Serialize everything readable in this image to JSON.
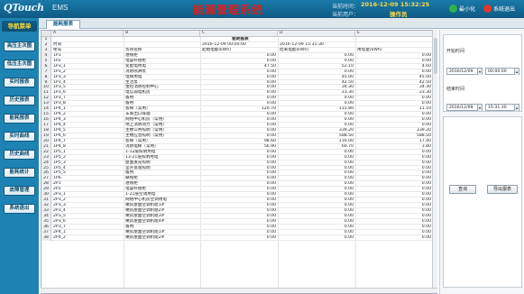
{
  "header": {
    "logo": "QTouch",
    "logo_sub": "EMS",
    "title": "能源管理系统",
    "time_label": "当前时间：",
    "time_value": "2016-12-09 15:32:25",
    "user_label": "当前用户：",
    "user_value": "操作员",
    "minimize_label": "最小化",
    "exit_label": "系统退出"
  },
  "sidebar": {
    "title": "导航菜单",
    "items": [
      "高压主次图",
      "低压主次图",
      "实时报表",
      "历史报表",
      "能耗报表",
      "实时曲线",
      "历史曲线",
      "能耗统计",
      "故障管理",
      "系统退出"
    ]
  },
  "tab": {
    "label": "能耗报表"
  },
  "sheet": {
    "columns": [
      "A",
      "B",
      "C",
      "D",
      "E"
    ],
    "title": "能耗报表",
    "time_label": "时间",
    "start_time": "2016-12-09 00:00:00",
    "end_time": "2016-12-09 15:31:30",
    "headers": [
      "柜号",
      "负荷名称",
      "起始电能(kWh)",
      "结束电能(kWh)",
      "用电量(kWh)"
    ],
    "rows": [
      [
        "1P1",
        "进线柜",
        "0.00",
        "0.00",
        "0.00"
      ],
      [
        "1P2",
        "电容补偿柜",
        "0.00",
        "0.00",
        "0.00"
      ],
      [
        "1P3_1",
        "变配电用电",
        "47.50",
        "52.10",
        "4.60"
      ],
      [
        "1P3_2",
        "消防喷淋泵",
        "0.00",
        "0.00",
        "0.00"
      ],
      [
        "1P3_3",
        "电梯用电",
        "0.00",
        "45.00",
        "45.00"
      ],
      [
        "1P3_4",
        "生活泵",
        "0.00",
        "42.50",
        "42.50"
      ],
      [
        "1P3_5",
        "金控消防控制中心",
        "0.00",
        "34.30",
        "34.30"
      ],
      [
        "1P3_6",
        "电信弱电机房",
        "0.00",
        "23.30",
        "23.30"
      ],
      [
        "1P3_7",
        "备用",
        "0.00",
        "0.00",
        "0.00"
      ],
      [
        "1P3_8",
        "备用",
        "0.00",
        "0.00",
        "0.00"
      ],
      [
        "1P4_1",
        "客梯（常用）",
        "120.70",
        "131.80",
        "11.10"
      ],
      [
        "1P4_2",
        "车库出口排烟",
        "0.00",
        "0.00",
        "0.00"
      ],
      [
        "1P4_3",
        "网络中心机房（常用）",
        "0.00",
        "0.00",
        "0.00"
      ],
      [
        "1P4_4",
        "地上消防动力（常用）",
        "0.00",
        "0.00",
        "0.00"
      ],
      [
        "1P4_5",
        "主楼公共照明（常用）",
        "0.00",
        "339.20",
        "339.20"
      ],
      [
        "1P4_6",
        "主楼应急照明（常用）",
        "0.00",
        "588.50",
        "588.50"
      ],
      [
        "1P4_7",
        "客梯（常用）",
        "98.60",
        "116.00",
        "17.40"
      ],
      [
        "1P4_8",
        "消防电梯（常用）",
        "56.90",
        "60.70",
        "3.80"
      ],
      [
        "1P5_1",
        "1-12层照明用电",
        "0.00",
        "0.00",
        "0.00"
      ],
      [
        "1P5_2",
        "13-21层照明用电",
        "0.00",
        "0.00",
        "0.00"
      ],
      [
        "1P5_3",
        "屋面发光照明",
        "0.00",
        "0.00",
        "0.00"
      ],
      [
        "1P5_4",
        "室外景观照明",
        "0.00",
        "0.00",
        "0.00"
      ],
      [
        "1P5_5",
        "备用",
        "0.00",
        "0.00",
        "0.00"
      ],
      [
        "1P6",
        "联络柜",
        "0.00",
        "0.00",
        "0.00"
      ],
      [
        "2P1",
        "进线柜",
        "0.00",
        "0.00",
        "0.00"
      ],
      [
        "2P2",
        "电容补偿柜",
        "0.00",
        "0.00",
        "0.00"
      ],
      [
        "2P3_1",
        "1-21层空调用电",
        "0.00",
        "0.00",
        "0.00"
      ],
      [
        "2P3_2",
        "网络中心机房空调用电",
        "0.00",
        "0.00",
        "0.00"
      ],
      [
        "2P3_3",
        "裙房屋面空调机组1#",
        "0.00",
        "0.00",
        "0.00"
      ],
      [
        "2P3_4",
        "裙房屋面空调机组2#",
        "0.00",
        "0.00",
        "0.00"
      ],
      [
        "2P3_5",
        "裙房屋面空调机组3#",
        "0.00",
        "0.00",
        "0.00"
      ],
      [
        "2P3_6",
        "裙房屋面空调机组4#",
        "0.00",
        "0.00",
        "0.00"
      ],
      [
        "2P3_7",
        "备用",
        "0.00",
        "0.00",
        "0.00"
      ],
      [
        "2P4_1",
        "裙房屋面空调机组1#",
        "0.00",
        "0.00",
        "0.00"
      ],
      [
        "2P4_2",
        "裙房屋面空调机组2#",
        "0.00",
        "0.00",
        "0.00"
      ]
    ]
  },
  "panel": {
    "start_label": "开始时间",
    "start_date": "2016/12/09",
    "start_time": "00:00:00",
    "end_label": "结束时间",
    "end_date": "2016/12/09",
    "end_time": "15:31:30",
    "query_button": "查询",
    "export_button": "导出报表"
  },
  "colors": {
    "header_bg": "#1a7aa8",
    "sidebar_bg": "#1e83b2",
    "title_red": "#d8201c",
    "accent_yellow": "#ffd84a"
  }
}
